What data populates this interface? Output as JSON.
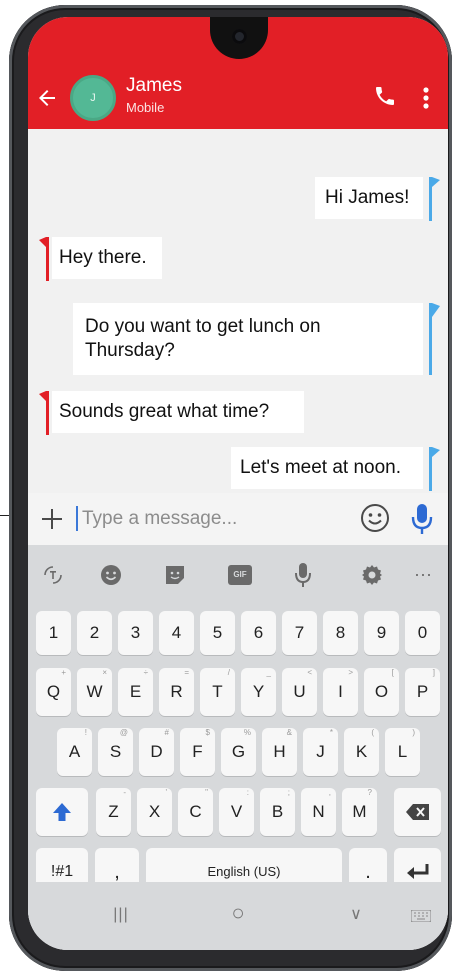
{
  "contact": {
    "name": "James",
    "subtitle": "Mobile",
    "avatar_initial": "J"
  },
  "icons": {
    "back": "back-arrow-icon",
    "call": "phone-icon",
    "menu": "more-vert-icon",
    "attach": "plus-icon",
    "emoji": "emoji-icon",
    "mic": "microphone-icon"
  },
  "colors": {
    "brand_red": "#e21f26",
    "sent_flag": "#4aa9e8",
    "received_flag": "#e21f26",
    "mic_blue": "#2d6ad3"
  },
  "messages": [
    {
      "text": "Hi James!",
      "direction": "sent"
    },
    {
      "text": "Hey there.",
      "direction": "received"
    },
    {
      "text": "Do you want to get lunch on Thursday?",
      "direction": "sent"
    },
    {
      "text": "Sounds great what time?",
      "direction": "received"
    },
    {
      "text": "Let's meet at noon.",
      "direction": "sent"
    }
  ],
  "composer": {
    "placeholder": "Type a message..."
  },
  "keyboard": {
    "toolbar": [
      "translate-icon",
      "emoji-icon",
      "sticker-icon",
      "gif-icon",
      "voice-icon",
      "settings-icon",
      "more-horiz-icon"
    ],
    "gif_label": "GIF",
    "more_label": "···",
    "numbers": [
      "1",
      "2",
      "3",
      "4",
      "5",
      "6",
      "7",
      "8",
      "9",
      "0"
    ],
    "row1": [
      "Q",
      "W",
      "E",
      "R",
      "T",
      "Y",
      "U",
      "I",
      "O",
      "P"
    ],
    "row1_hints": [
      "+",
      "×",
      "÷",
      "=",
      "/",
      "_",
      "<",
      ">",
      "[",
      "]"
    ],
    "row2": [
      "A",
      "S",
      "D",
      "F",
      "G",
      "H",
      "J",
      "K",
      "L"
    ],
    "row2_hints": [
      "!",
      "@",
      "#",
      "$",
      "%",
      "&",
      "*",
      "(",
      ")"
    ],
    "row3": [
      "Z",
      "X",
      "C",
      "V",
      "B",
      "N",
      "M"
    ],
    "row3_hints": [
      "-",
      "'",
      "\"",
      ":",
      ";",
      ",",
      "?"
    ],
    "symbols_label": "!#1",
    "comma_label": ",",
    "space_label": "English (US)",
    "period_label": "."
  },
  "navbar": {
    "recent_label": "|||",
    "home_label": "○",
    "back_label": "∨"
  }
}
